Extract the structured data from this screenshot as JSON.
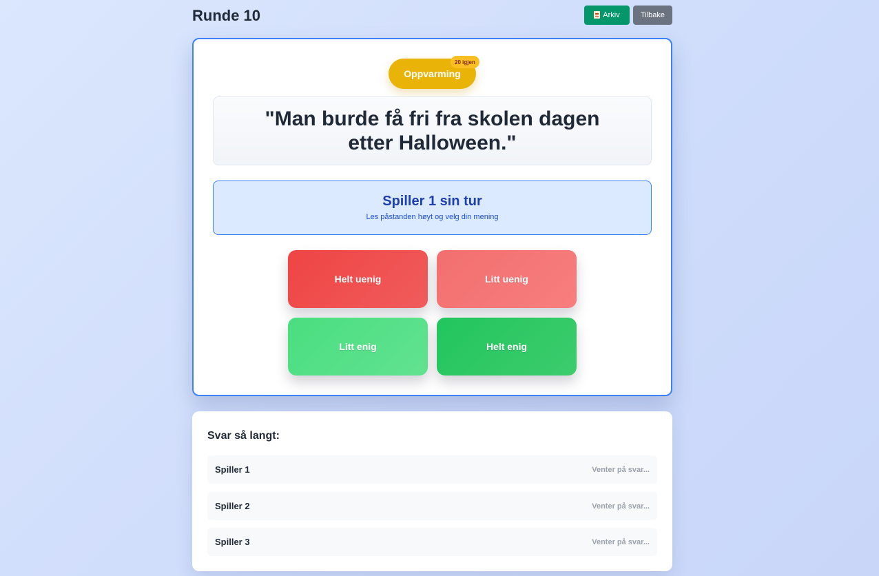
{
  "header": {
    "title": "Runde 10",
    "archive_label": "Arkiv",
    "archive_icon": "document-icon",
    "back_label": "Tilbake"
  },
  "card": {
    "category": "Oppvarming",
    "remaining_badge": "20 igjen",
    "statement": "\"Man burde få fri fra skolen dagen etter Halloween.\"",
    "turn_title": "Spiller 1 sin tur",
    "turn_subtitle": "Les påstanden høyt og velg din mening"
  },
  "choices": [
    {
      "label": "Helt uenig",
      "color": "#ef4444"
    },
    {
      "label": "Litt uenig",
      "color": "#f87171"
    },
    {
      "label": "Litt enig",
      "color": "#4ade80"
    },
    {
      "label": "Helt enig",
      "color": "#22c55e"
    }
  ],
  "answers": {
    "title": "Svar så langt:",
    "rows": [
      {
        "player": "Spiller 1",
        "status": "Venter på svar..."
      },
      {
        "player": "Spiller 2",
        "status": "Venter på svar..."
      },
      {
        "player": "Spiller 3",
        "status": "Venter på svar..."
      }
    ]
  },
  "colors": {
    "accent": "#3b82f6",
    "category_pill": "#eab308",
    "archive_button": "#059669",
    "back_button": "#6b7280"
  }
}
